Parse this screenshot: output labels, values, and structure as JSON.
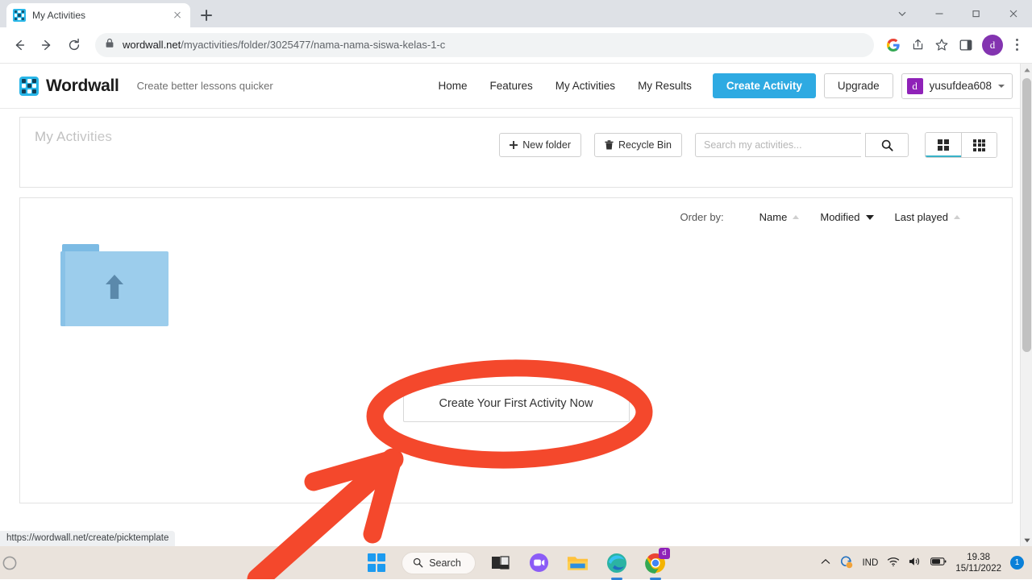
{
  "browser": {
    "tab": {
      "title": "My Activities",
      "favicon_icon": "wordwall-grid-icon",
      "close_icon": "close-icon"
    },
    "new_tab_icon": "plus-icon",
    "window_controls": {
      "tab_search_icon": "chevron-down-icon",
      "minimize_icon": "minimize-icon",
      "maximize_icon": "maximize-icon",
      "close_icon": "close-icon"
    },
    "nav": {
      "back_icon": "arrow-left-icon",
      "forward_icon": "arrow-right-icon",
      "reload_icon": "reload-icon"
    },
    "omnibox": {
      "lock_icon": "lock-icon",
      "host": "wordwall.net",
      "path": "/myactivities/folder/3025477/nama-nama-siswa-kelas-1-c",
      "full_url": "wordwall.net/myactivities/folder/3025477/nama-nama-siswa-kelas-1-c"
    },
    "toolbar_icons": [
      "google-icon",
      "share-icon",
      "bookmark-star-icon",
      "side-panel-icon"
    ],
    "profile_initial": "d",
    "menu_icon": "kebab-menu-icon"
  },
  "site": {
    "brand_name": "Wordwall",
    "brand_icon": "wordwall-grid-icon",
    "tagline": "Create better lessons quicker",
    "nav_links": [
      "Home",
      "Features",
      "My Activities",
      "My Results"
    ],
    "create_activity_label": "Create Activity",
    "upgrade_label": "Upgrade",
    "user": {
      "initial": "d",
      "name": "yusufdea608",
      "caret_icon": "chevron-down-icon"
    },
    "colors": {
      "accent_blue": "#2eaae2",
      "avatar_purple": "#8f22b8",
      "annotation_red": "#f4482c"
    }
  },
  "toolbar": {
    "page_title": "My Activities",
    "new_folder_label": "New folder",
    "new_folder_icon": "plus-icon",
    "recycle_bin_label": "Recycle Bin",
    "recycle_bin_icon": "trash-icon",
    "search_placeholder": "Search my activities...",
    "search_value": "",
    "search_button_icon": "search-icon",
    "view_large_icon": "grid-large-icon",
    "view_small_icon": "grid-small-icon",
    "active_view": "large"
  },
  "order_bar": {
    "label": "Order by:",
    "options": [
      {
        "label": "Name",
        "sort_icon": "triangle-up-icon",
        "active": false
      },
      {
        "label": "Modified",
        "sort_icon": "triangle-down-icon",
        "active": true
      },
      {
        "label": "Last played",
        "sort_icon": "triangle-up-icon",
        "active": false
      }
    ]
  },
  "content": {
    "parent_folder_icon": "folder-up-icon",
    "first_activity_label": "Create Your First Activity Now"
  },
  "annotations": {
    "ellipse": "red-ellipse-highlight",
    "arrow": "red-arrow-pointer",
    "color": "#f4482c"
  },
  "status_bar": {
    "url": "https://wordwall.net/create/picktemplate"
  },
  "taskbar": {
    "start_icon": "windows-start-icon",
    "search_label": "Search",
    "search_icon": "search-icon",
    "apps": [
      {
        "name": "task-view-icon"
      },
      {
        "name": "chat-icon"
      },
      {
        "name": "file-explorer-icon"
      },
      {
        "name": "edge-icon"
      },
      {
        "name": "chrome-icon",
        "badge": "d"
      }
    ],
    "tray": {
      "overflow_icon": "chevron-up-icon",
      "sync_icon": "onedrive-sync-icon",
      "language": "IND",
      "wifi_icon": "wifi-icon",
      "volume_icon": "volume-icon",
      "battery_icon": "battery-icon",
      "time": "19.38",
      "date": "15/11/2022",
      "notification_count": "1"
    }
  }
}
